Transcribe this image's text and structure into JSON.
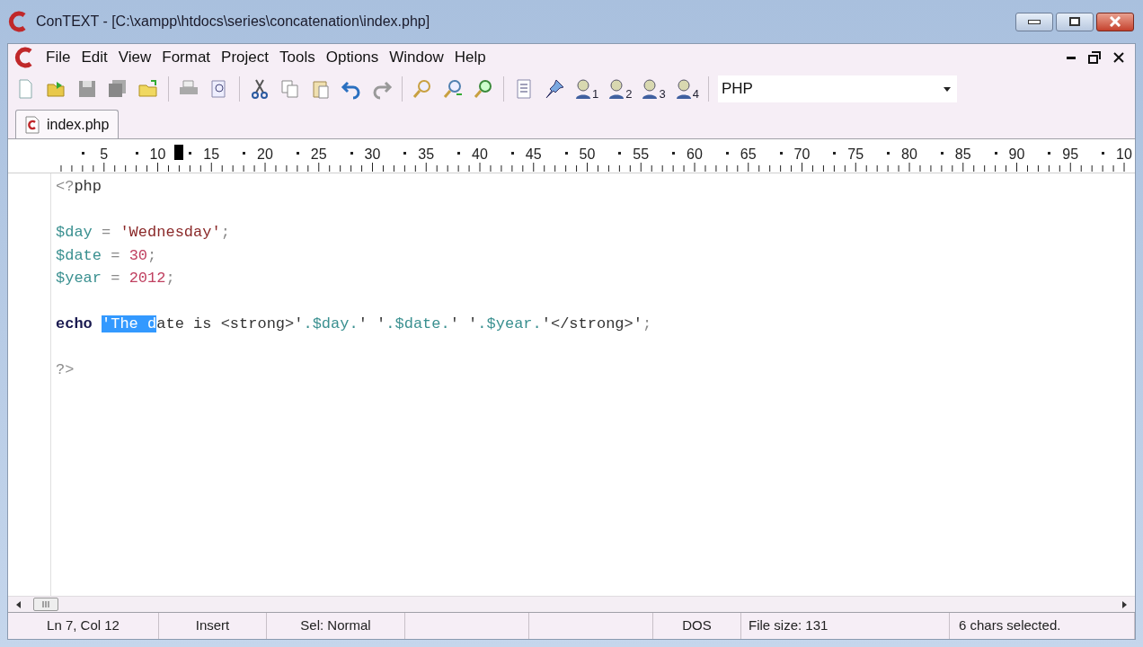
{
  "window": {
    "title": "ConTEXT - [C:\\xampp\\htdocs\\series\\concatenation\\index.php]"
  },
  "menu": [
    "File",
    "Edit",
    "View",
    "Format",
    "Project",
    "Tools",
    "Options",
    "Window",
    "Help"
  ],
  "user_tools": [
    "1",
    "2",
    "3",
    "4"
  ],
  "highlighter": {
    "value": "PHP"
  },
  "tabs": [
    {
      "label": "index.php",
      "selected": true
    }
  ],
  "ruler": [
    "5",
    "10",
    "15",
    "20",
    "25",
    "30",
    "35",
    "40",
    "45",
    "50",
    "55",
    "60",
    "65",
    "70",
    "75",
    "80",
    "85",
    "90",
    "95",
    "10"
  ],
  "code_lines": [
    {
      "blank_before": false,
      "tokens": [
        {
          "text": "<?",
          "kind": "op",
          "selected": false
        },
        {
          "text": "php",
          "kind": "plain",
          "selected": false
        }
      ]
    },
    {
      "blank_before": true,
      "tokens": [
        {
          "text": "$day",
          "kind": "var",
          "selected": false
        },
        {
          "text": " = ",
          "kind": "op",
          "selected": false
        },
        {
          "text": "'Wednesday'",
          "kind": "string",
          "selected": false
        },
        {
          "text": ";",
          "kind": "op",
          "selected": false
        }
      ]
    },
    {
      "blank_before": false,
      "tokens": [
        {
          "text": "$date",
          "kind": "var",
          "selected": false
        },
        {
          "text": " = ",
          "kind": "op",
          "selected": false
        },
        {
          "text": "30",
          "kind": "number",
          "selected": false
        },
        {
          "text": ";",
          "kind": "op",
          "selected": false
        }
      ]
    },
    {
      "blank_before": false,
      "tokens": [
        {
          "text": "$year",
          "kind": "var",
          "selected": false
        },
        {
          "text": " = ",
          "kind": "op",
          "selected": false
        },
        {
          "text": "2012",
          "kind": "number",
          "selected": false
        },
        {
          "text": ";",
          "kind": "op",
          "selected": false
        }
      ]
    },
    {
      "blank_before": true,
      "tokens": [
        {
          "text": "echo ",
          "kind": "keyword",
          "selected": false
        },
        {
          "text": "'The d",
          "kind": "plain",
          "selected": true
        },
        {
          "text": "ate is <strong>'",
          "kind": "plain",
          "selected": false
        },
        {
          "text": ".$day.",
          "kind": "var",
          "selected": false
        },
        {
          "text": "' '",
          "kind": "plain",
          "selected": false
        },
        {
          "text": ".$date.",
          "kind": "var",
          "selected": false
        },
        {
          "text": "' '",
          "kind": "plain",
          "selected": false
        },
        {
          "text": ".$year.",
          "kind": "var",
          "selected": false
        },
        {
          "text": "'</strong>'",
          "kind": "plain",
          "selected": false
        },
        {
          "text": ";",
          "kind": "op",
          "selected": false
        }
      ]
    },
    {
      "blank_before": true,
      "tokens": [
        {
          "text": "?>",
          "kind": "op",
          "selected": false
        }
      ]
    }
  ],
  "status_bar": [
    "Ln 7, Col 12",
    "Insert",
    "Sel: Normal",
    "DOS",
    "File size: 131",
    "6 chars selected."
  ]
}
